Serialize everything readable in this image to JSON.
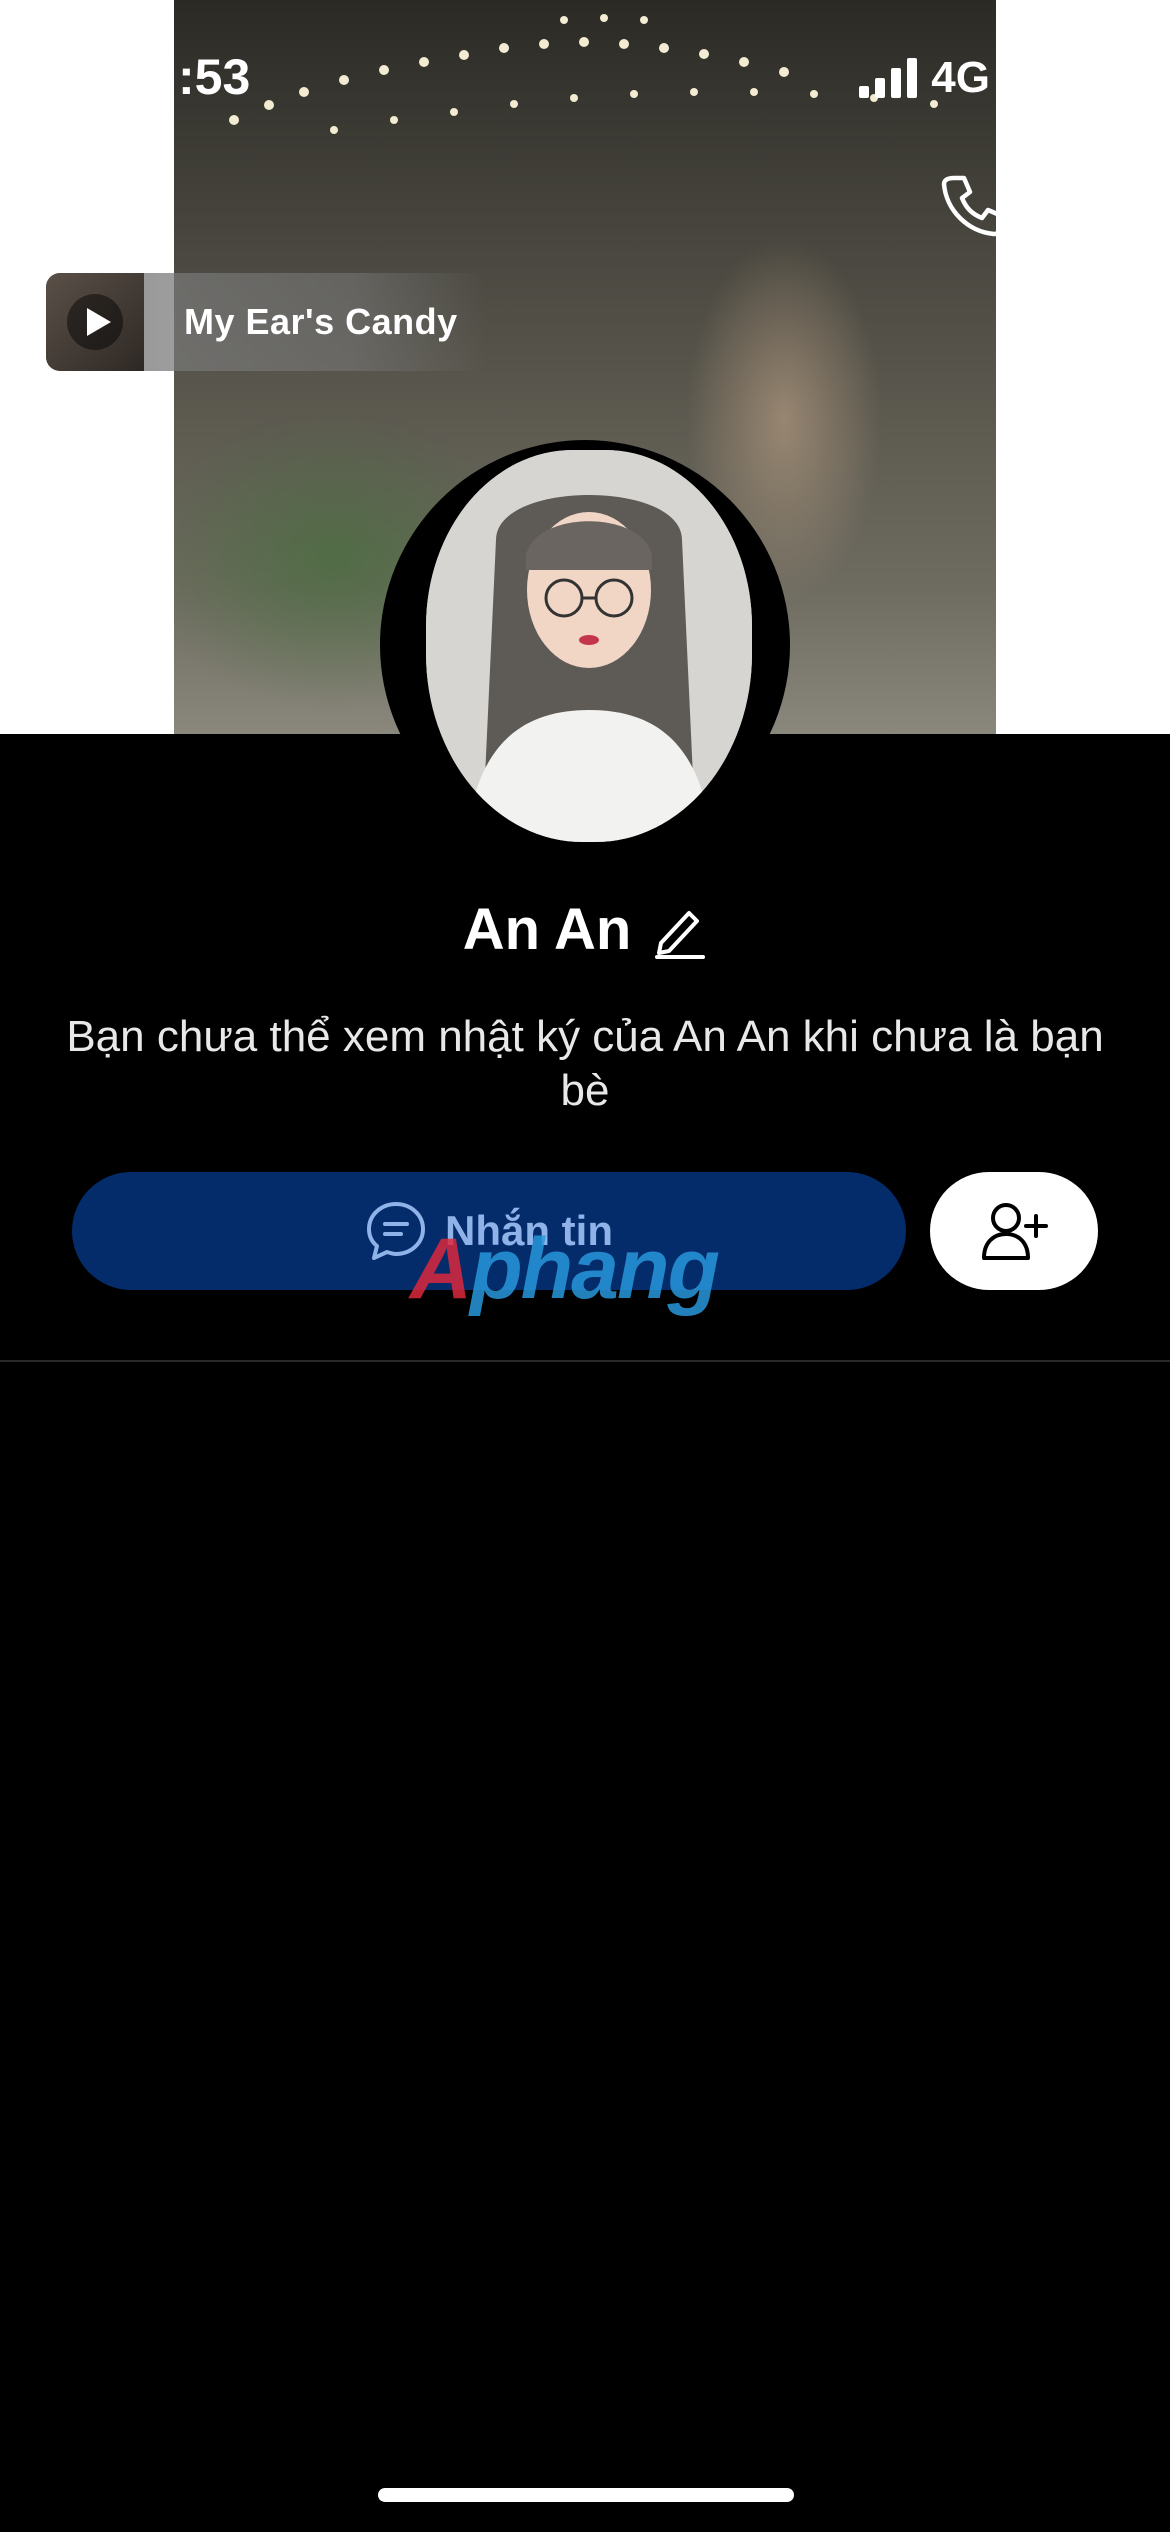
{
  "status_bar": {
    "time": ":53",
    "network": "4G"
  },
  "nav": {
    "back_icon": "chevron-left-icon",
    "call_icon": "phone-icon",
    "more_icon": "more-dots-icon"
  },
  "music": {
    "title": "My Ear's Candy",
    "play_icon": "play-icon"
  },
  "profile": {
    "name": "An An",
    "description": "Bạn chưa thể xem nhật ký của An An khi chưa là bạn bè"
  },
  "actions": {
    "message_label": "Nhắn tin",
    "message_icon": "chat-bubble-icon",
    "add_friend_icon": "add-user-icon"
  },
  "watermark": {
    "part_a": "A",
    "part_b": "phang"
  },
  "colors": {
    "message_button": "#042c6b",
    "message_text": "#8fb2e8",
    "background": "#000000"
  }
}
